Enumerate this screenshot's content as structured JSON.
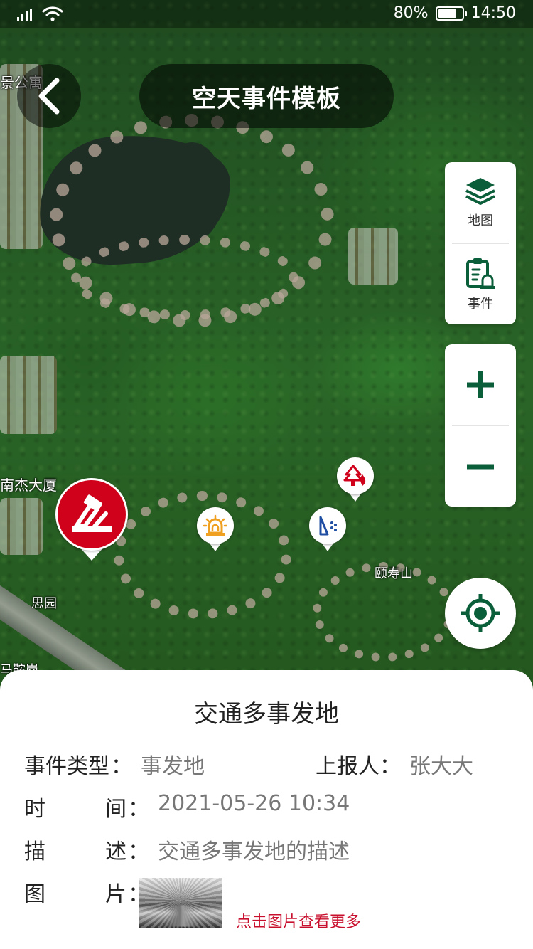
{
  "status_bar": {
    "battery": "80%",
    "time": "14:50",
    "battery_level": 0.8
  },
  "header": {
    "title": "空天事件模板"
  },
  "map": {
    "labels": {
      "top_left": "景公寓",
      "building": "南杰大厦",
      "hill": "颐寿山",
      "garden": "思园",
      "bottom_left": "马鞍岗"
    }
  },
  "controls": {
    "layer_label": "地图",
    "event_label": "事件",
    "zoom_in": "+",
    "zoom_out": "−"
  },
  "colors": {
    "accent_green": "#0b5e3a",
    "marker_red": "#d0021b",
    "alarm_orange": "#f0a020",
    "water_blue": "#1f4ea3",
    "link_red": "#c8102e"
  },
  "event_detail": {
    "title": "交通多事发地",
    "type_key": "事件类型",
    "type_value": "事发地",
    "reporter_key": "上报人",
    "reporter_value": "张大大",
    "time_key_a": "时",
    "time_key_b": "间",
    "time_value": "2021-05-26 10:34",
    "desc_key_a": "描",
    "desc_key_b": "述",
    "desc_value": "交通多事发地的描述",
    "pic_key_a": "图",
    "pic_key_b": "片",
    "colon": "：",
    "more_link": "点击图片查看更多"
  }
}
